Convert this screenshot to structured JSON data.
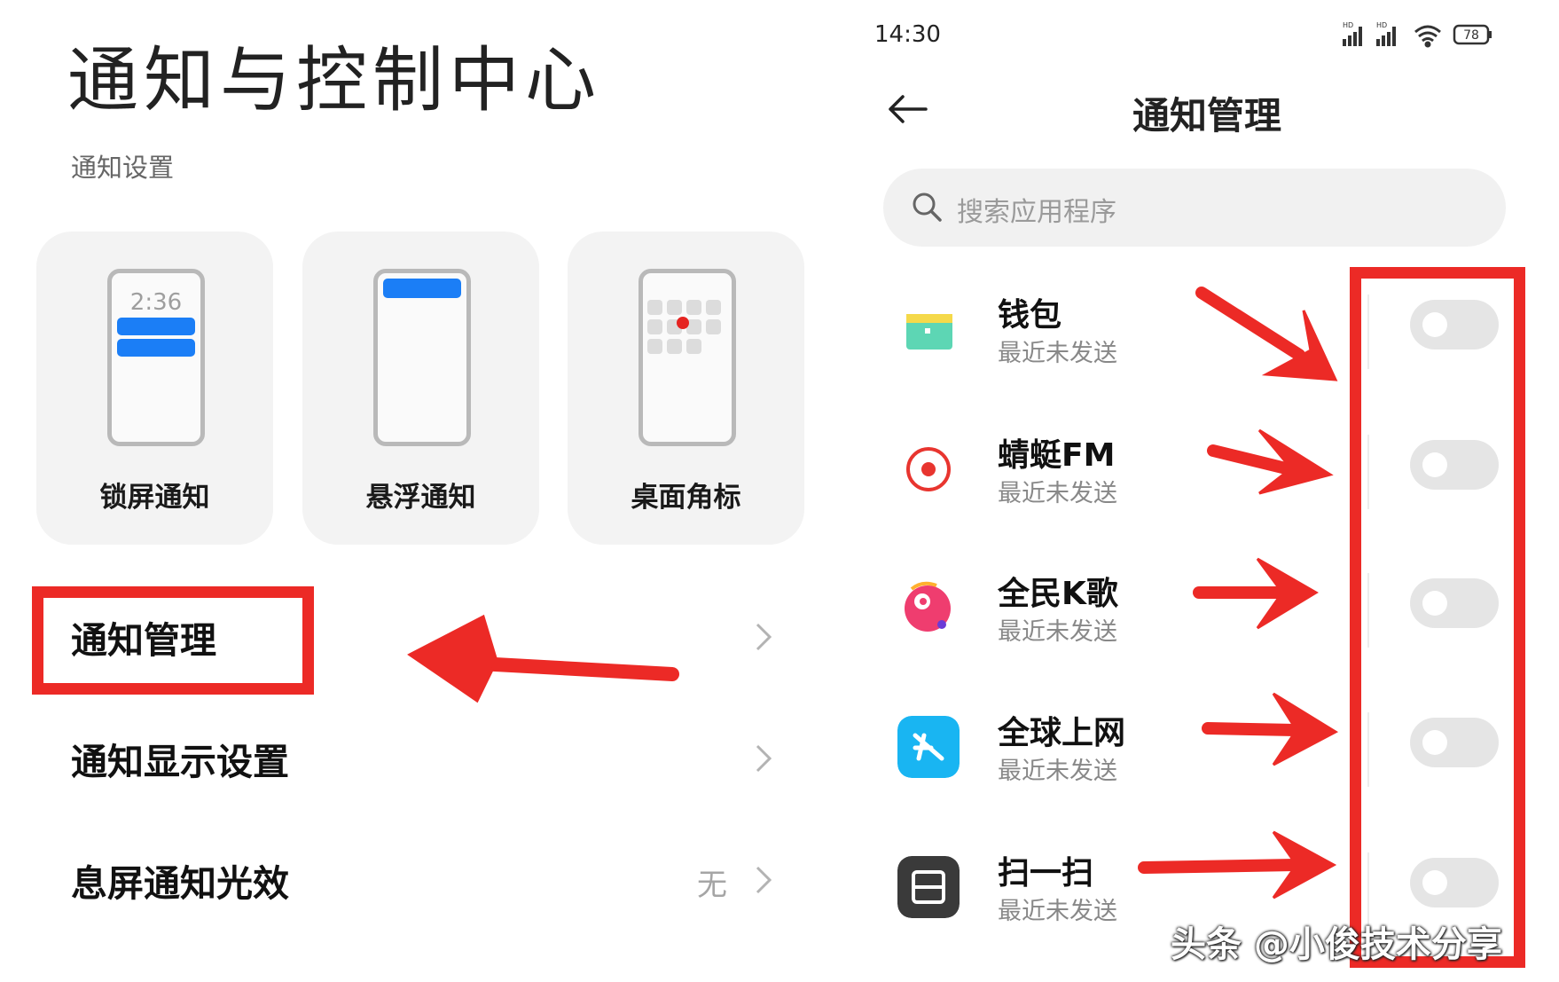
{
  "left": {
    "title": "通知与控制中心",
    "section": "通知设置",
    "cards": [
      {
        "label": "锁屏通知",
        "time": "2:36"
      },
      {
        "label": "悬浮通知"
      },
      {
        "label": "桌面角标"
      }
    ],
    "rows": [
      {
        "label": "通知管理"
      },
      {
        "label": "通知显示设置"
      },
      {
        "label": "息屏通知光效",
        "value": "无"
      }
    ]
  },
  "right": {
    "status_time": "14:30",
    "battery": "78",
    "nav_title": "通知管理",
    "search_placeholder": "搜索应用程序",
    "apps": [
      {
        "name": "钱包",
        "sub": "最近未发送",
        "icon": "wallet-icon",
        "color": "#3ec7a8",
        "enabled": false
      },
      {
        "name": "蜻蜓FM",
        "sub": "最近未发送",
        "icon": "dragonfly-fm-icon",
        "color": "#e8352f",
        "enabled": false
      },
      {
        "name": "全民K歌",
        "sub": "最近未发送",
        "icon": "karaoke-icon",
        "color": "#ef3d6f",
        "enabled": false
      },
      {
        "name": "全球上网",
        "sub": "最近未发送",
        "icon": "global-internet-icon",
        "color": "#19b5f2",
        "enabled": false
      },
      {
        "name": "扫一扫",
        "sub": "最近未发送",
        "icon": "scanner-icon",
        "color": "#3a3a3a",
        "enabled": false
      }
    ]
  },
  "watermark": "头条 @小俊技术分享",
  "colors": {
    "accent": "#1b7ef6",
    "highlight": "#ec2a26"
  }
}
